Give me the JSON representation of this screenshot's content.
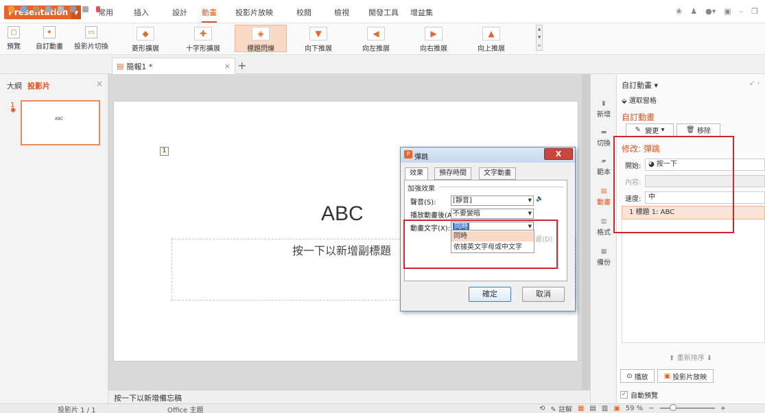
{
  "app": {
    "brand": "Presentation"
  },
  "menu_tabs": [
    "常用",
    "插入",
    "設計",
    "動畫",
    "投影片放映",
    "校閱",
    "檢視",
    "開發工具",
    "增益集"
  ],
  "active_menu_tab": "動畫",
  "ribbon": {
    "preview": "預覽",
    "custom_animation": "自訂動畫",
    "slide_transition": "投影片切換",
    "animations": [
      "菱形擴展",
      "十字形擴展",
      "標題閃爍",
      "向下推展",
      "向左推展",
      "向右推展",
      "向上推展"
    ],
    "selected_animation": "標題閃爍"
  },
  "doc_tab": {
    "name": "簡報1 *"
  },
  "left_panel": {
    "tab_outline": "大綱",
    "tab_slides": "投影片",
    "slide_number": "1",
    "thumb_text": "ABC"
  },
  "slide": {
    "anim_tag": "1",
    "title": "ABC",
    "subtitle_placeholder": "按一下以新增副標題"
  },
  "notes_placeholder": "按一下以新增備忘稿",
  "right_column": {
    "new": "新增",
    "switch": "切換",
    "template": "範本",
    "animation": "動畫",
    "format": "格式",
    "backup": "備份"
  },
  "task_pane": {
    "header": "自訂動畫",
    "select_pane": "選取窗格",
    "title": "自訂動畫",
    "change_label": "變更",
    "remove_label": "移除",
    "modify_title": "修改: 彈跳",
    "start_label": "開始:",
    "start_value": "按一下",
    "content_label": "內容:",
    "content_value": "",
    "speed_label": "速度:",
    "speed_value": "中",
    "list_item": "1  標題 1: ABC",
    "reorder_label": "重新排序",
    "play_label": "播放",
    "slideshow_label": "投影片放映",
    "auto_preview_label": "自動預覽"
  },
  "dialog": {
    "title": "彈跳",
    "close_label": "X",
    "tabs": [
      "效果",
      "預存時間",
      "文字動畫"
    ],
    "group_label": "加強效果",
    "sound_label": "聲音(S):",
    "sound_value": "[靜音]",
    "after_label": "播放動畫後(A",
    "after_value": "不要變暗",
    "text_label": "動畫文字(X):",
    "text_value": "同時",
    "dropdown_options": [
      "同時",
      "依據英文字母或中文字"
    ],
    "delay_fragment": "遲(D)",
    "ok_label": "確定",
    "cancel_label": "取消"
  },
  "status_bar": {
    "slide_info": "投影片 1 / 1",
    "theme": "Office 主題",
    "notes_label": "註解",
    "zoom": "59 %"
  },
  "colors": {
    "accent": "#e8642a",
    "highlight_red": "#d0252b",
    "selected_fill": "#fbd9c7"
  }
}
